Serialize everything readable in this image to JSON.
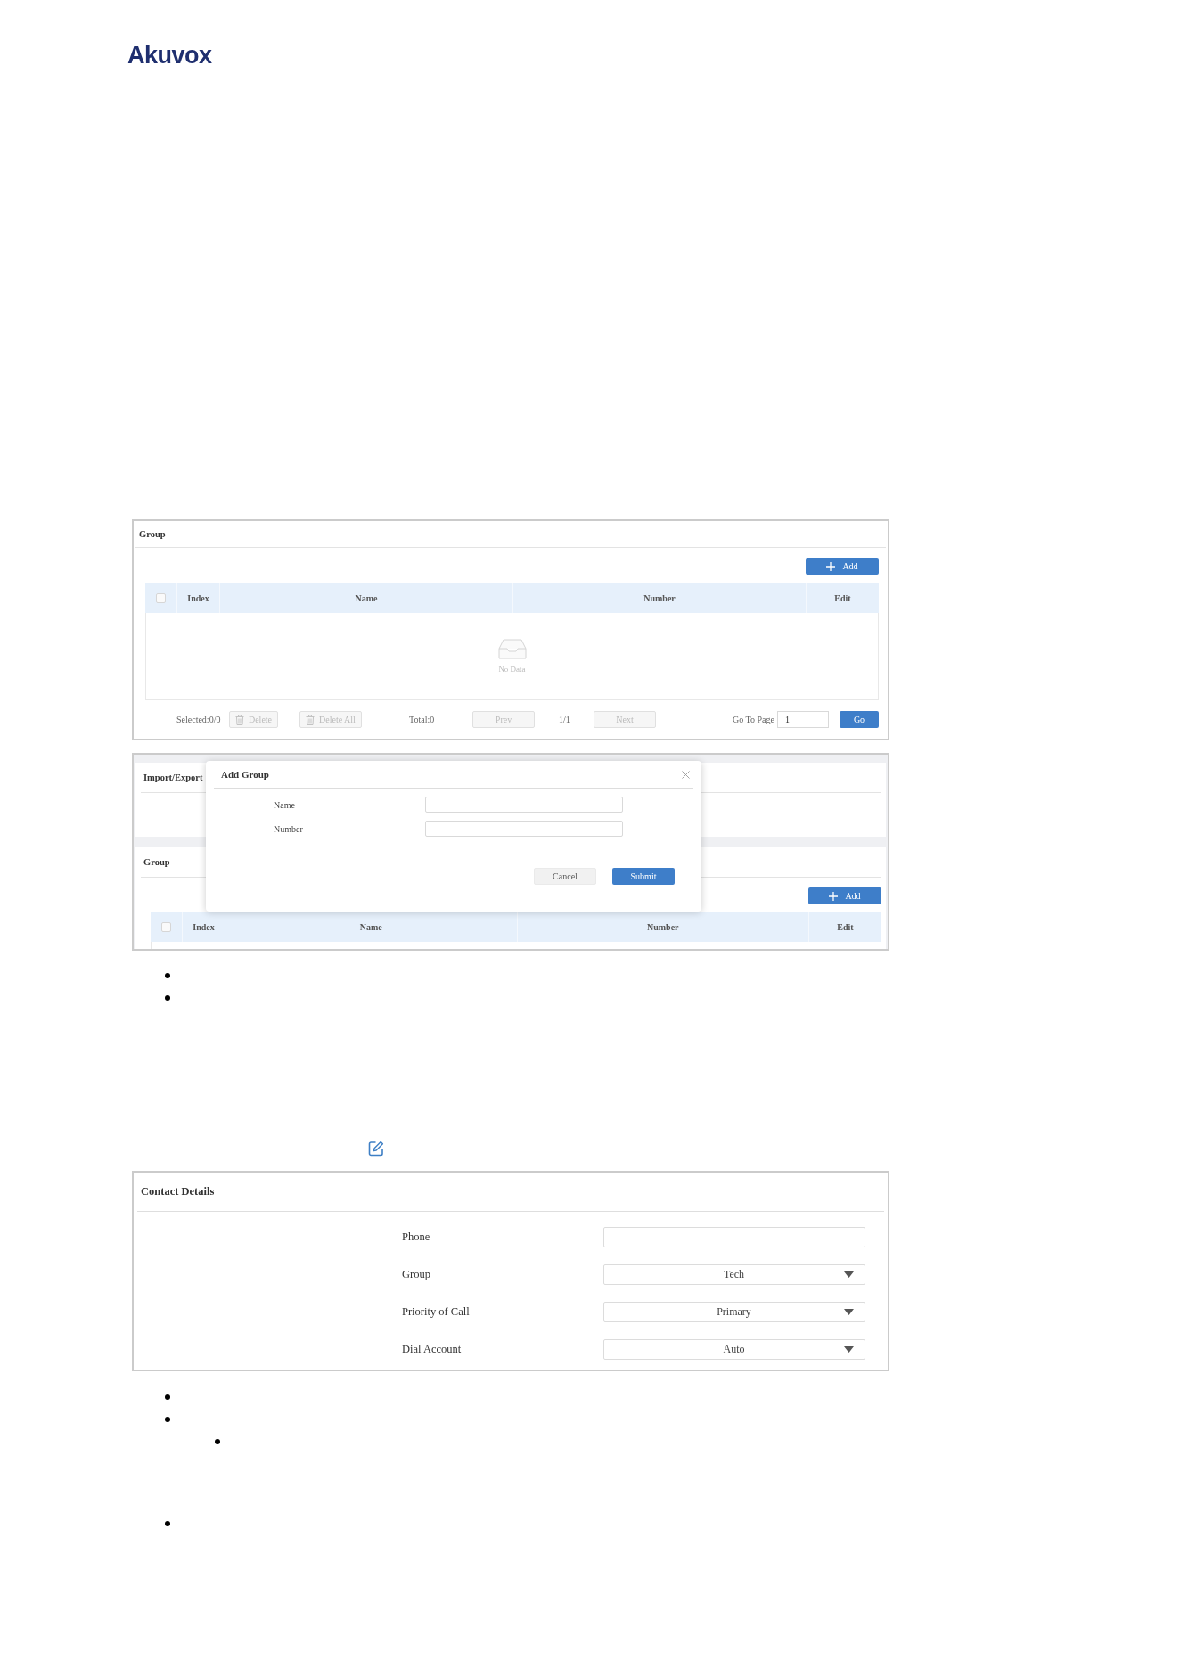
{
  "logo": "Akuvox",
  "group_screenshot": {
    "title": "Group",
    "add_button": "Add",
    "table": {
      "select_all": {
        "checked": false
      },
      "columns": [
        "Index",
        "Name",
        "Number",
        "Edit"
      ],
      "empty_text": "No Data"
    },
    "footer": {
      "selected": "Selected:0/0",
      "delete_button": {
        "label": "Delete",
        "disabled": true
      },
      "delete_all_button": {
        "label": "Delete All",
        "disabled": true
      },
      "total": "Total:0",
      "prev_button": {
        "label": "Prev",
        "disabled": true
      },
      "page": "1/1",
      "next_button": {
        "label": "Next",
        "disabled": true
      },
      "go_to_page": "Go To Page",
      "page_input": "1",
      "go_button": "Go"
    }
  },
  "add_group_screenshot": {
    "sections": [
      {
        "title": "Import/Export"
      },
      {
        "title": "Group",
        "add_button": "Add",
        "table": {
          "select_all": {
            "checked": false
          },
          "columns": [
            "Index",
            "Name",
            "Number",
            "Edit"
          ]
        }
      }
    ],
    "dialog": {
      "title": "Add Group",
      "fields": [
        {
          "label": "Name"
        },
        {
          "label": "Number"
        }
      ],
      "cancel_button": "Cancel",
      "submit_button": "Submit"
    }
  },
  "bullets_1": [
    {
      "kind": "bullet"
    },
    {
      "kind": "bullet"
    }
  ],
  "contact_screenshot": {
    "title": "Contact Details",
    "fields": [
      {
        "label": "Phone",
        "kind": "text"
      },
      {
        "label": "Group",
        "kind": "select",
        "value": "Tech"
      },
      {
        "label": "Priority of Call",
        "kind": "select",
        "value": "Primary"
      },
      {
        "label": "Dial Account",
        "kind": "select",
        "value": "Auto"
      }
    ]
  },
  "bullets_2": [
    {
      "kind": "bullet"
    },
    {
      "kind": "bullet",
      "children": [
        {
          "kind": "bullet"
        }
      ]
    }
  ],
  "bullets_3": [
    {
      "kind": "bullet"
    }
  ]
}
